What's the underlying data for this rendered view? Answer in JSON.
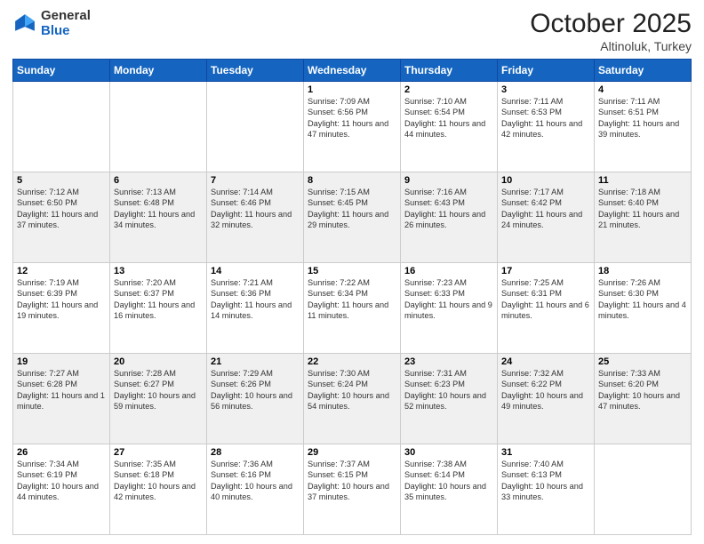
{
  "logo": {
    "general": "General",
    "blue": "Blue"
  },
  "header": {
    "month": "October 2025",
    "location": "Altinoluk, Turkey"
  },
  "days_of_week": [
    "Sunday",
    "Monday",
    "Tuesday",
    "Wednesday",
    "Thursday",
    "Friday",
    "Saturday"
  ],
  "weeks": [
    [
      {
        "day": "",
        "info": ""
      },
      {
        "day": "",
        "info": ""
      },
      {
        "day": "",
        "info": ""
      },
      {
        "day": "1",
        "info": "Sunrise: 7:09 AM\nSunset: 6:56 PM\nDaylight: 11 hours and 47 minutes."
      },
      {
        "day": "2",
        "info": "Sunrise: 7:10 AM\nSunset: 6:54 PM\nDaylight: 11 hours and 44 minutes."
      },
      {
        "day": "3",
        "info": "Sunrise: 7:11 AM\nSunset: 6:53 PM\nDaylight: 11 hours and 42 minutes."
      },
      {
        "day": "4",
        "info": "Sunrise: 7:11 AM\nSunset: 6:51 PM\nDaylight: 11 hours and 39 minutes."
      }
    ],
    [
      {
        "day": "5",
        "info": "Sunrise: 7:12 AM\nSunset: 6:50 PM\nDaylight: 11 hours and 37 minutes."
      },
      {
        "day": "6",
        "info": "Sunrise: 7:13 AM\nSunset: 6:48 PM\nDaylight: 11 hours and 34 minutes."
      },
      {
        "day": "7",
        "info": "Sunrise: 7:14 AM\nSunset: 6:46 PM\nDaylight: 11 hours and 32 minutes."
      },
      {
        "day": "8",
        "info": "Sunrise: 7:15 AM\nSunset: 6:45 PM\nDaylight: 11 hours and 29 minutes."
      },
      {
        "day": "9",
        "info": "Sunrise: 7:16 AM\nSunset: 6:43 PM\nDaylight: 11 hours and 26 minutes."
      },
      {
        "day": "10",
        "info": "Sunrise: 7:17 AM\nSunset: 6:42 PM\nDaylight: 11 hours and 24 minutes."
      },
      {
        "day": "11",
        "info": "Sunrise: 7:18 AM\nSunset: 6:40 PM\nDaylight: 11 hours and 21 minutes."
      }
    ],
    [
      {
        "day": "12",
        "info": "Sunrise: 7:19 AM\nSunset: 6:39 PM\nDaylight: 11 hours and 19 minutes."
      },
      {
        "day": "13",
        "info": "Sunrise: 7:20 AM\nSunset: 6:37 PM\nDaylight: 11 hours and 16 minutes."
      },
      {
        "day": "14",
        "info": "Sunrise: 7:21 AM\nSunset: 6:36 PM\nDaylight: 11 hours and 14 minutes."
      },
      {
        "day": "15",
        "info": "Sunrise: 7:22 AM\nSunset: 6:34 PM\nDaylight: 11 hours and 11 minutes."
      },
      {
        "day": "16",
        "info": "Sunrise: 7:23 AM\nSunset: 6:33 PM\nDaylight: 11 hours and 9 minutes."
      },
      {
        "day": "17",
        "info": "Sunrise: 7:25 AM\nSunset: 6:31 PM\nDaylight: 11 hours and 6 minutes."
      },
      {
        "day": "18",
        "info": "Sunrise: 7:26 AM\nSunset: 6:30 PM\nDaylight: 11 hours and 4 minutes."
      }
    ],
    [
      {
        "day": "19",
        "info": "Sunrise: 7:27 AM\nSunset: 6:28 PM\nDaylight: 11 hours and 1 minute."
      },
      {
        "day": "20",
        "info": "Sunrise: 7:28 AM\nSunset: 6:27 PM\nDaylight: 10 hours and 59 minutes."
      },
      {
        "day": "21",
        "info": "Sunrise: 7:29 AM\nSunset: 6:26 PM\nDaylight: 10 hours and 56 minutes."
      },
      {
        "day": "22",
        "info": "Sunrise: 7:30 AM\nSunset: 6:24 PM\nDaylight: 10 hours and 54 minutes."
      },
      {
        "day": "23",
        "info": "Sunrise: 7:31 AM\nSunset: 6:23 PM\nDaylight: 10 hours and 52 minutes."
      },
      {
        "day": "24",
        "info": "Sunrise: 7:32 AM\nSunset: 6:22 PM\nDaylight: 10 hours and 49 minutes."
      },
      {
        "day": "25",
        "info": "Sunrise: 7:33 AM\nSunset: 6:20 PM\nDaylight: 10 hours and 47 minutes."
      }
    ],
    [
      {
        "day": "26",
        "info": "Sunrise: 7:34 AM\nSunset: 6:19 PM\nDaylight: 10 hours and 44 minutes."
      },
      {
        "day": "27",
        "info": "Sunrise: 7:35 AM\nSunset: 6:18 PM\nDaylight: 10 hours and 42 minutes."
      },
      {
        "day": "28",
        "info": "Sunrise: 7:36 AM\nSunset: 6:16 PM\nDaylight: 10 hours and 40 minutes."
      },
      {
        "day": "29",
        "info": "Sunrise: 7:37 AM\nSunset: 6:15 PM\nDaylight: 10 hours and 37 minutes."
      },
      {
        "day": "30",
        "info": "Sunrise: 7:38 AM\nSunset: 6:14 PM\nDaylight: 10 hours and 35 minutes."
      },
      {
        "day": "31",
        "info": "Sunrise: 7:40 AM\nSunset: 6:13 PM\nDaylight: 10 hours and 33 minutes."
      },
      {
        "day": "",
        "info": ""
      }
    ]
  ]
}
